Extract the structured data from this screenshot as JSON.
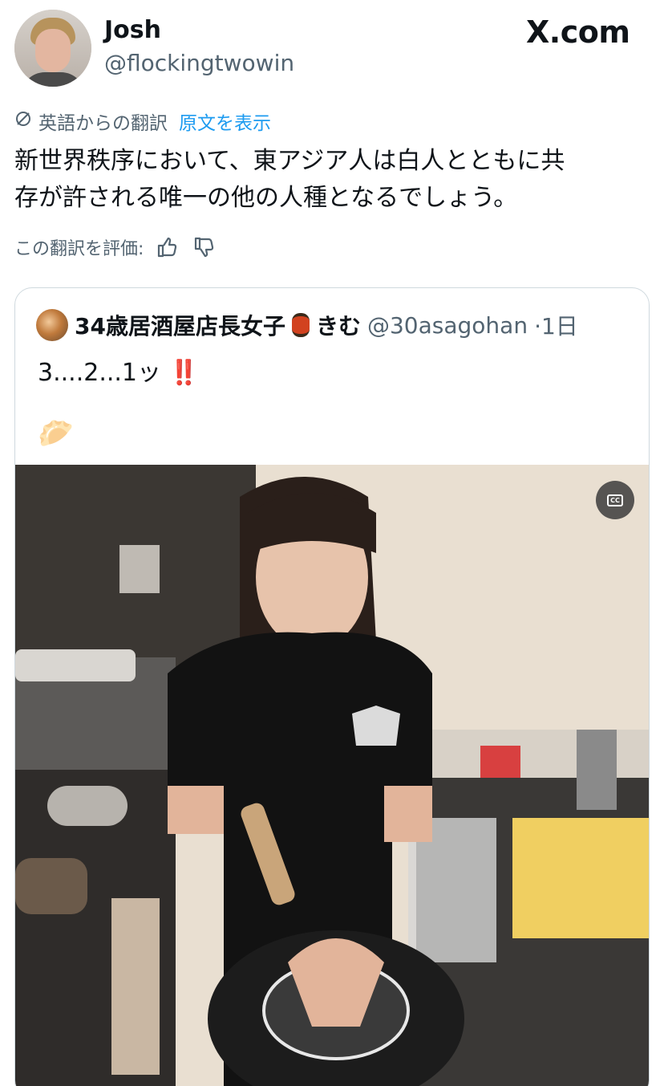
{
  "header": {
    "name": "Josh",
    "handle": "@flockingtwowin",
    "site": "X.com"
  },
  "translation": {
    "label": "英語からの翻訳",
    "show_original": "原文を表示"
  },
  "tweet": {
    "line1": "新世界秩序において、東アジア人は白人とともに共",
    "line2": "存が許される唯一の他の人種となるでしょう。"
  },
  "rating": {
    "label": "この翻訳を評価:"
  },
  "quote": {
    "name": "34歳居酒屋店長女子",
    "name_suffix": "きむ",
    "handle": "@30asagohan",
    "time": "·1日",
    "text": "3....2...1ッ",
    "text_mark": "‼️",
    "emoji": "🥟"
  },
  "icons": {
    "translate": "translate-globe-icon",
    "thumbs_up": "thumbs-up-icon",
    "thumbs_down": "thumbs-down-icon",
    "closed_captions": "closed-captions-icon"
  }
}
